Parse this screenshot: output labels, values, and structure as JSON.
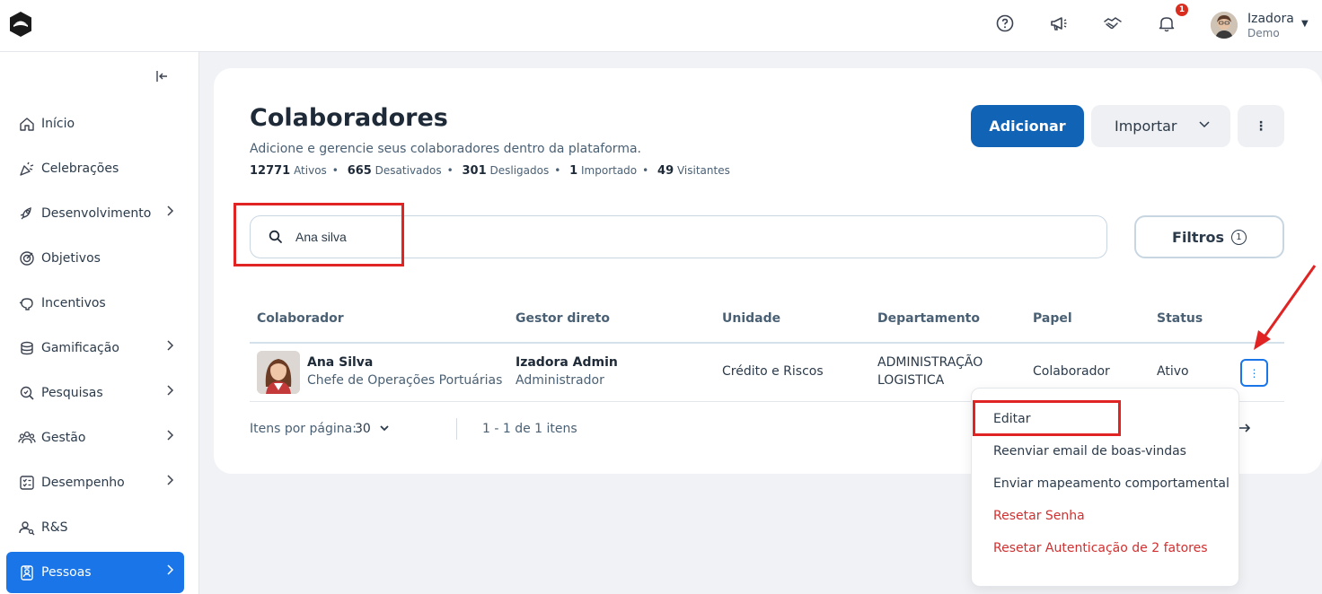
{
  "topbar": {
    "notification_count": "1",
    "user_name": "Izadora",
    "user_role": "Demo",
    "icons": [
      "help-icon",
      "megaphone-icon",
      "handshake-icon",
      "bell-icon"
    ]
  },
  "sidebar": {
    "items": [
      {
        "label": "Início",
        "icon": "home-icon",
        "has_chevron": false
      },
      {
        "label": "Celebrações",
        "icon": "party-icon",
        "has_chevron": false
      },
      {
        "label": "Desenvolvimento",
        "icon": "rocket-icon",
        "has_chevron": true
      },
      {
        "label": "Objetivos",
        "icon": "target-icon",
        "has_chevron": false
      },
      {
        "label": "Incentivos",
        "icon": "piggy-bank-icon",
        "has_chevron": false
      },
      {
        "label": "Gamificação",
        "icon": "coins-icon",
        "has_chevron": true
      },
      {
        "label": "Pesquisas",
        "icon": "survey-icon",
        "has_chevron": true
      },
      {
        "label": "Gestão",
        "icon": "team-icon",
        "has_chevron": true
      },
      {
        "label": "Desempenho",
        "icon": "checklist-icon",
        "has_chevron": true
      },
      {
        "label": "R&S",
        "icon": "people-search-icon",
        "has_chevron": false
      },
      {
        "label": "Pessoas",
        "icon": "badge-icon",
        "has_chevron": true,
        "active": true
      }
    ]
  },
  "header": {
    "title": "Colaboradores",
    "subtitle": "Adicione e gerencie seus colaboradores dentro da plataforma.",
    "stats": [
      {
        "value": "12771",
        "label": "Ativos"
      },
      {
        "value": "665",
        "label": "Desativados"
      },
      {
        "value": "301",
        "label": "Desligados"
      },
      {
        "value": "1",
        "label": "Importado"
      },
      {
        "value": "49",
        "label": "Visitantes"
      }
    ],
    "add_label": "Adicionar",
    "import_label": "Importar"
  },
  "search": {
    "value": "Ana silva",
    "placeholder": ""
  },
  "filters": {
    "label": "Filtros",
    "count": "1"
  },
  "table": {
    "columns": [
      "Colaborador",
      "Gestor direto",
      "Unidade",
      "Departamento",
      "Papel",
      "Status"
    ],
    "rows": [
      {
        "name": "Ana Silva",
        "role": "Chefe de Operações Portuárias",
        "manager_name": "Izadora Admin",
        "manager_role": "Administrador",
        "unit": "Crédito e Riscos",
        "department_line1": "ADMINISTRAÇÃO",
        "department_line2": "LOGISTICA",
        "papel": "Colaborador",
        "status": "Ativo"
      }
    ]
  },
  "pagination": {
    "per_page_label": "Itens por página:",
    "per_page_value": "30",
    "range": "1 - 1 de 1 itens"
  },
  "row_menu": {
    "items": [
      {
        "label": "Editar",
        "danger": false
      },
      {
        "label": "Reenviar email de boas-vindas",
        "danger": false
      },
      {
        "label": "Enviar mapeamento comportamental",
        "danger": false
      },
      {
        "label": "Resetar Senha",
        "danger": true
      },
      {
        "label": "Resetar Autenticação de 2 fatores",
        "danger": true
      }
    ]
  },
  "colors": {
    "primary": "#1163b5",
    "active_nav": "#1a75e8",
    "danger": "#d03030",
    "annotation": "#e02424"
  }
}
